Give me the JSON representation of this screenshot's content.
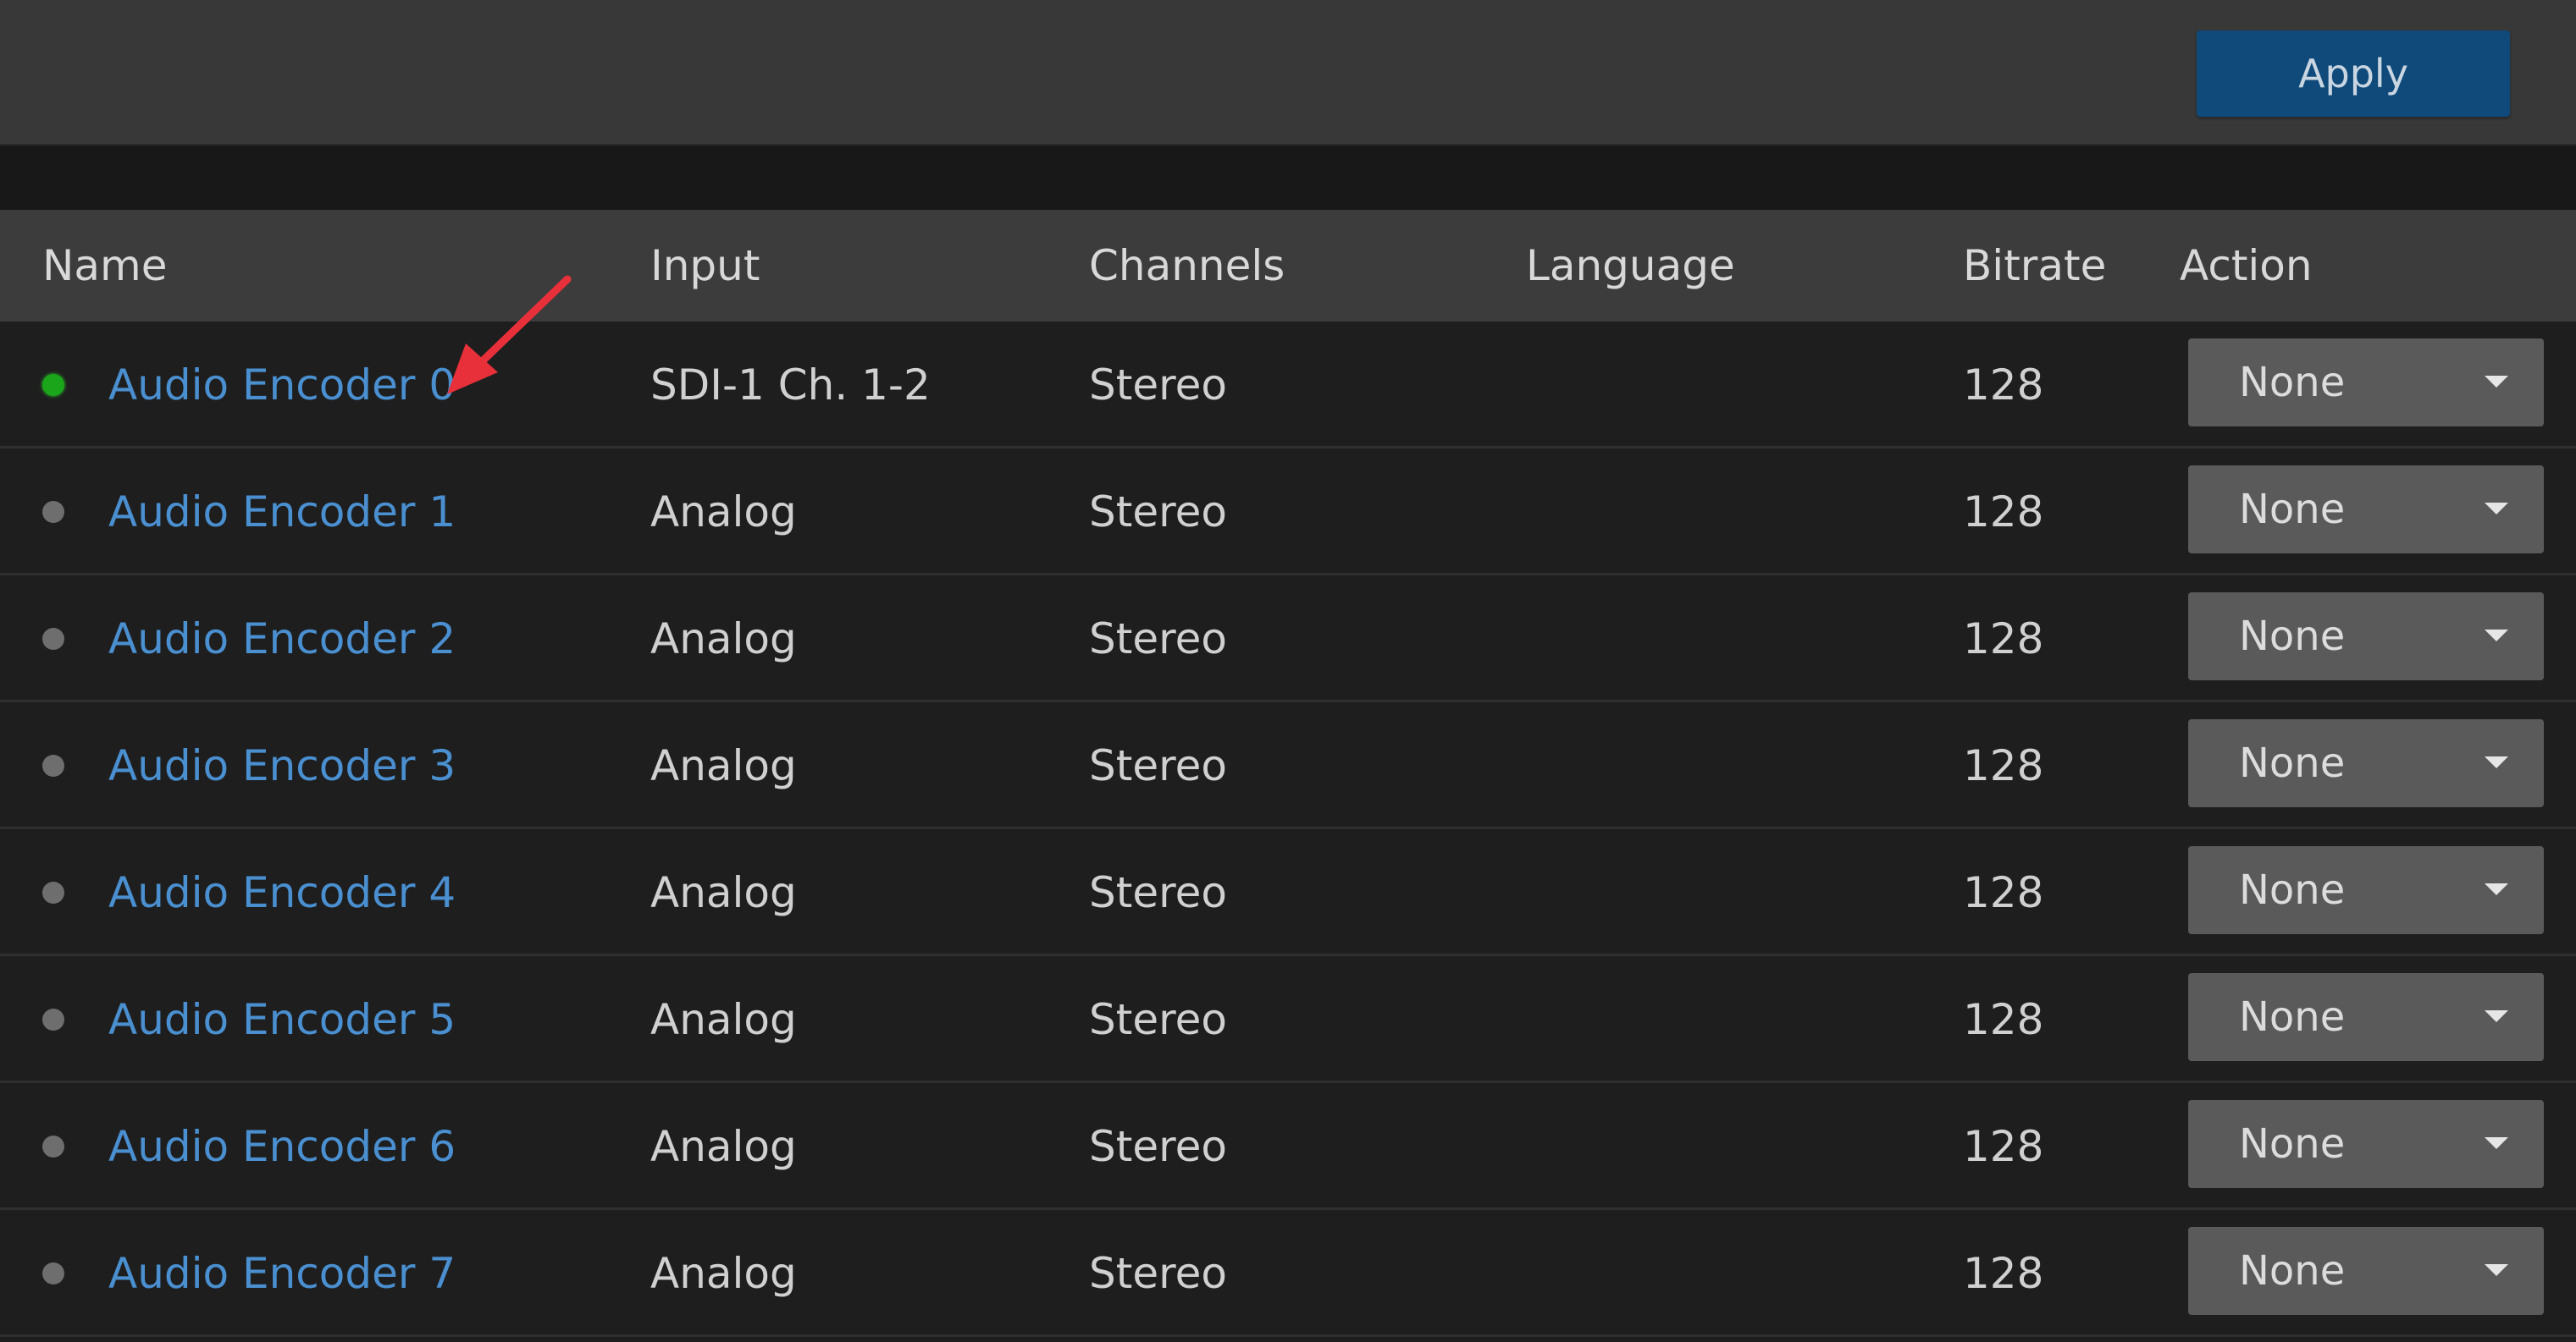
{
  "toolbar": {
    "apply_label": "Apply"
  },
  "table": {
    "columns": {
      "name": "Name",
      "input": "Input",
      "channels": "Channels",
      "language": "Language",
      "bitrate": "Bitrate",
      "action": "Action"
    },
    "rows": [
      {
        "name": "Audio Encoder 0",
        "input": "SDI-1 Ch. 1-2",
        "channels": "Stereo",
        "language": "",
        "bitrate": "128",
        "action": "None",
        "status": "active"
      },
      {
        "name": "Audio Encoder 1",
        "input": "Analog",
        "channels": "Stereo",
        "language": "",
        "bitrate": "128",
        "action": "None",
        "status": "inactive"
      },
      {
        "name": "Audio Encoder 2",
        "input": "Analog",
        "channels": "Stereo",
        "language": "",
        "bitrate": "128",
        "action": "None",
        "status": "inactive"
      },
      {
        "name": "Audio Encoder 3",
        "input": "Analog",
        "channels": "Stereo",
        "language": "",
        "bitrate": "128",
        "action": "None",
        "status": "inactive"
      },
      {
        "name": "Audio Encoder 4",
        "input": "Analog",
        "channels": "Stereo",
        "language": "",
        "bitrate": "128",
        "action": "None",
        "status": "inactive"
      },
      {
        "name": "Audio Encoder 5",
        "input": "Analog",
        "channels": "Stereo",
        "language": "",
        "bitrate": "128",
        "action": "None",
        "status": "inactive"
      },
      {
        "name": "Audio Encoder 6",
        "input": "Analog",
        "channels": "Stereo",
        "language": "",
        "bitrate": "128",
        "action": "None",
        "status": "inactive"
      },
      {
        "name": "Audio Encoder 7",
        "input": "Analog",
        "channels": "Stereo",
        "language": "",
        "bitrate": "128",
        "action": "None",
        "status": "inactive"
      }
    ]
  },
  "icons": {
    "status_active": "status-dot-green",
    "status_inactive": "status-dot-gray",
    "dropdown": "chevron-down-icon",
    "annotation": "red-arrow-annotation"
  },
  "colors": {
    "apply_button": "#0f4a7a",
    "link": "#4a8fd0",
    "status_active": "#1aa51a",
    "status_inactive": "#6e6e6e",
    "annotation_arrow": "#e8303a"
  }
}
